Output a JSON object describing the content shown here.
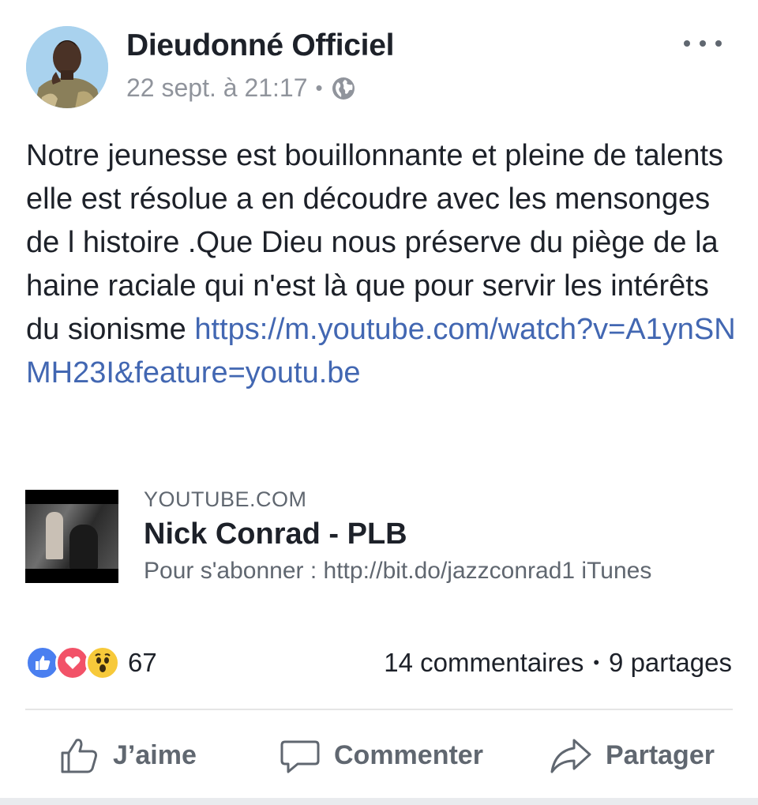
{
  "post": {
    "author": "Dieudonné Officiel",
    "timestamp": "22 sept. à 21:17",
    "separator": "•",
    "visibility_icon": "globe-icon",
    "more_icon": "more-options-icon",
    "text": "Notre jeunesse est bouillonnante et pleine de talents elle est résolue a en  découdre avec les mensonges de l histoire .Que Dieu nous préserve du piège de la haine raciale qui n'est là que pour servir les intérêts du sionisme ",
    "link": "https://m.youtube.com/watch?v=A1ynSNMH23I&feature=youtu.be"
  },
  "preview": {
    "site": "YOUTUBE.COM",
    "title": "Nick Conrad - PLB",
    "description": "Pour s'abonner : http://bit.do/jazzconrad1 iTunes"
  },
  "reactions": {
    "icons": [
      "like-icon",
      "love-icon",
      "wow-icon"
    ],
    "count": "67",
    "comments": "14 commentaires",
    "separator": "•",
    "shares": "9 partages"
  },
  "actions": {
    "like": "J’aime",
    "comment": "Commenter",
    "share": "Partager"
  },
  "colors": {
    "link": "#4267b2",
    "secondary_text": "#90949c",
    "like_blue": "#4a7ff0",
    "love_red": "#f25268",
    "wow_yellow": "#f7c93a"
  }
}
